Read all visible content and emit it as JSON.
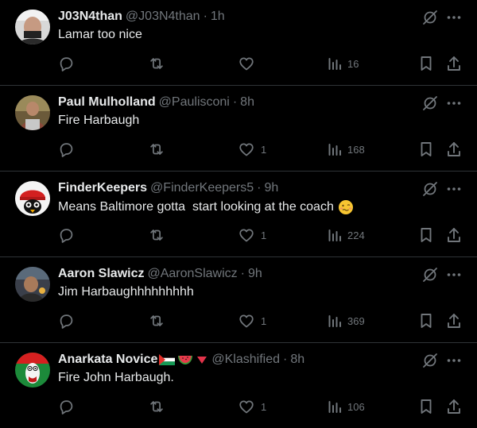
{
  "tweets": [
    {
      "name": "J03N4than",
      "handle": "@J03N4than",
      "separator": "·",
      "time": "1h",
      "text": "Lamar too nice",
      "likes": "",
      "views": "16",
      "avatar": "avatar-icon"
    },
    {
      "name": "Paul Mulholland",
      "handle": "@Paulisconi",
      "separator": "·",
      "time": "8h",
      "text": "Fire Harbaugh",
      "likes": "1",
      "views": "168",
      "avatar": "avatar-icon"
    },
    {
      "name": "FinderKeepers",
      "handle": "@FinderKeepers5",
      "separator": "·",
      "time": "9h",
      "text": "Means Baltimore gotta  start looking at the coach",
      "likes": "1",
      "views": "224",
      "avatar": "avatar-icon"
    },
    {
      "name": "Aaron Slawicz",
      "handle": "@AaronSlawicz",
      "separator": "·",
      "time": "9h",
      "text": "Jim Harbaughhhhhhhhh",
      "likes": "1",
      "views": "369",
      "avatar": "avatar-icon"
    },
    {
      "name": "Anarkata Novice",
      "handle": "@Klashified",
      "separator": "·",
      "time": "8h",
      "text": "Fire John Harbaugh.",
      "likes": "1",
      "views": "106",
      "avatar": "avatar-icon"
    }
  ],
  "colors": {
    "background": "#000000",
    "text": "#e7e9ea",
    "muted": "#71767b",
    "divider": "#2f3336"
  }
}
